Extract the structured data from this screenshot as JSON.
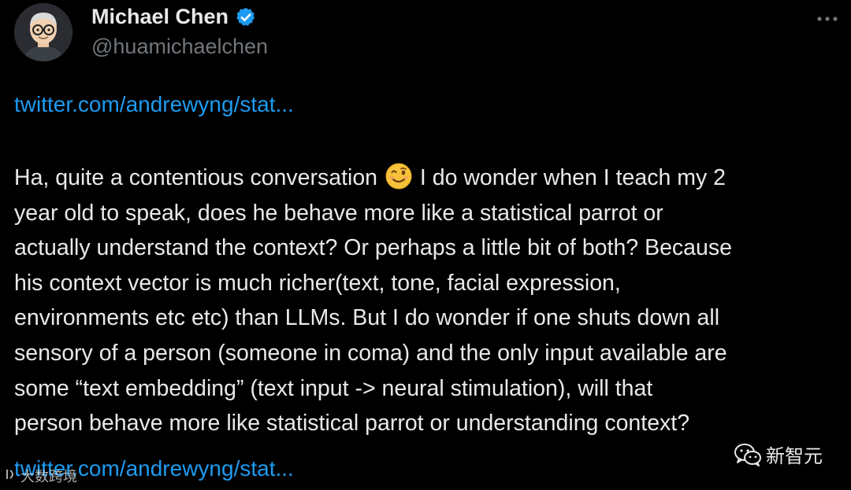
{
  "tweet": {
    "author": {
      "display_name": "Michael Chen",
      "handle": "@huamichaelchen",
      "verified": true
    },
    "link_top": "twitter.com/andrewyng/stat...",
    "body_before_emoji": "Ha, quite a contentious conversation ",
    "emoji": "winking-face",
    "body_after_emoji": " I do wonder when I teach my 2\nyear old to speak, does he behave more like a statistical parrot or\nactually understand the context? Or perhaps a little bit of both? Because\nhis context vector is much richer(text, tone, facial expression,\nenvironments etc etc) than LLMs. But I do wonder if one shuts down all\nsensory of a person (someone in coma) and the only input available are\nsome “text embedding” (text input -> neural stimulation), will that\nperson behave more like statistical parrot or understanding context?",
    "link_bottom": "twitter.com/andrewyng/stat..."
  },
  "watermarks": {
    "right_label": "新智元",
    "left_label": "大数跨境"
  },
  "colors": {
    "background": "#000000",
    "text": "#e7e9ea",
    "secondary": "#71767b",
    "link": "#1d9bf0",
    "verified": "#1d9bf0"
  },
  "icons": [
    "avatar",
    "verified-badge-icon",
    "more-options-icon",
    "winking-face-emoji",
    "wechat-icon"
  ]
}
